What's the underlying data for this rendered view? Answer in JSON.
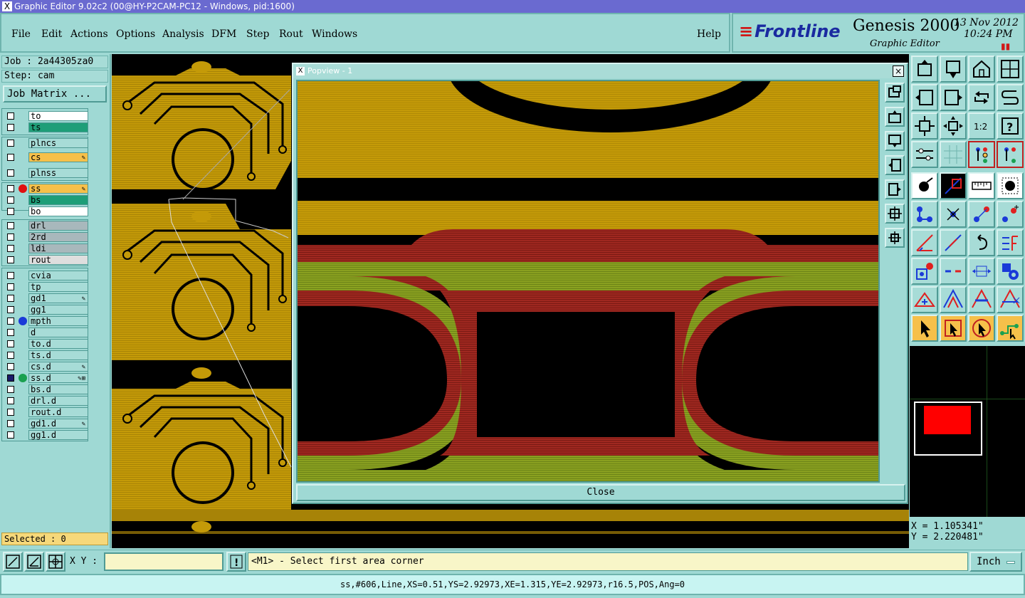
{
  "window": {
    "title": "Graphic Editor 9.02c2 (00@HY-P2CAM-PC12 - Windows, pid:1600)"
  },
  "menu": {
    "file": "File",
    "edit": "Edit",
    "actions": "Actions",
    "options": "Options",
    "analysis": "Analysis",
    "dfm": "DFM",
    "step": "Step",
    "rout": "Rout",
    "windows": "Windows",
    "help": "Help"
  },
  "brand": {
    "logo": "Frontline",
    "product": "Genesis 2000",
    "subtitle": "Graphic Editor",
    "date": "13 Nov 2012",
    "time": "10:24 PM"
  },
  "job": {
    "job_line": "Job : 2a44305za0",
    "step_line": "Step: cam",
    "matrix_label": "Job Matrix ..."
  },
  "layers": [
    {
      "name": "to",
      "bg": "#ffffff",
      "dot": "",
      "edit": ""
    },
    {
      "name": "ts",
      "bg": "#1e9e78",
      "dot": "",
      "edit": ""
    },
    {
      "name": "plncs",
      "bg": "#a7dcd7",
      "dot": "",
      "edit": ""
    },
    {
      "name": "cs",
      "bg": "#f6c04a",
      "dot": "",
      "edit": "✎"
    },
    {
      "name": "plnss",
      "bg": "#a7dcd7",
      "dot": "",
      "edit": ""
    },
    {
      "name": "ss",
      "bg": "#f6c04a",
      "dot": "#e01010",
      "edit": "✎"
    },
    {
      "name": "bs",
      "bg": "#1e9e78",
      "dot": "",
      "edit": ""
    },
    {
      "name": "bo",
      "bg": "#ffffff",
      "dot": "",
      "edit": ""
    },
    {
      "name": "drl",
      "bg": "#a8b8bc",
      "dot": "",
      "edit": ""
    },
    {
      "name": "2rd",
      "bg": "#a8b8bc",
      "dot": "",
      "edit": ""
    },
    {
      "name": "ldi",
      "bg": "#a8b8bc",
      "dot": "",
      "edit": ""
    },
    {
      "name": "rout",
      "bg": "#dedede",
      "dot": "",
      "edit": ""
    },
    {
      "name": "cvia",
      "bg": "#a7dcd7",
      "dot": "",
      "edit": ""
    },
    {
      "name": "tp",
      "bg": "#a7dcd7",
      "dot": "",
      "edit": ""
    },
    {
      "name": "gd1",
      "bg": "#a7dcd7",
      "dot": "",
      "edit": "✎"
    },
    {
      "name": "gg1",
      "bg": "#a7dcd7",
      "dot": "",
      "edit": ""
    },
    {
      "name": "mpth",
      "bg": "#a7dcd7",
      "dot": "#1a3ad8",
      "edit": ""
    },
    {
      "name": "d",
      "bg": "#a7dcd7",
      "dot": "",
      "edit": ""
    },
    {
      "name": "to.d",
      "bg": "#a7dcd7",
      "dot": "",
      "edit": ""
    },
    {
      "name": "ts.d",
      "bg": "#a7dcd7",
      "dot": "",
      "edit": ""
    },
    {
      "name": "cs.d",
      "bg": "#a7dcd7",
      "dot": "",
      "edit": "✎"
    },
    {
      "name": "ss.d",
      "bg": "#a7dcd7",
      "dot": "#1aa050",
      "edit": "✎⊞"
    },
    {
      "name": "bs.d",
      "bg": "#a7dcd7",
      "dot": "",
      "edit": ""
    },
    {
      "name": "drl.d",
      "bg": "#a7dcd7",
      "dot": "",
      "edit": ""
    },
    {
      "name": "rout.d",
      "bg": "#a7dcd7",
      "dot": "",
      "edit": ""
    },
    {
      "name": "gd1.d",
      "bg": "#a7dcd7",
      "dot": "",
      "edit": "✎"
    },
    {
      "name": "gg1.d",
      "bg": "#a7dcd7",
      "dot": "",
      "edit": ""
    }
  ],
  "selected": "Selected : 0",
  "popview": {
    "title": "Popview - 1",
    "close_x": "×",
    "close_label": "Close"
  },
  "coords": {
    "x": "X = 1.105341\"",
    "y": "Y = 2.220481\""
  },
  "bottom": {
    "xy_label": "X Y :",
    "xy_value": "",
    "info_icon": "!",
    "prompt": "<M1> - Select first area corner",
    "unit": "Inch"
  },
  "status": "ss,#606,Line,XS=0.51,YS=2.92973,XE=1.315,YE=2.92973,r16.5,POS,Ang=0",
  "colors": {
    "copper": "#c49a08",
    "solder_red": "#a02820",
    "mask_green": "#8aa020",
    "panel": "#9fd9d4"
  }
}
